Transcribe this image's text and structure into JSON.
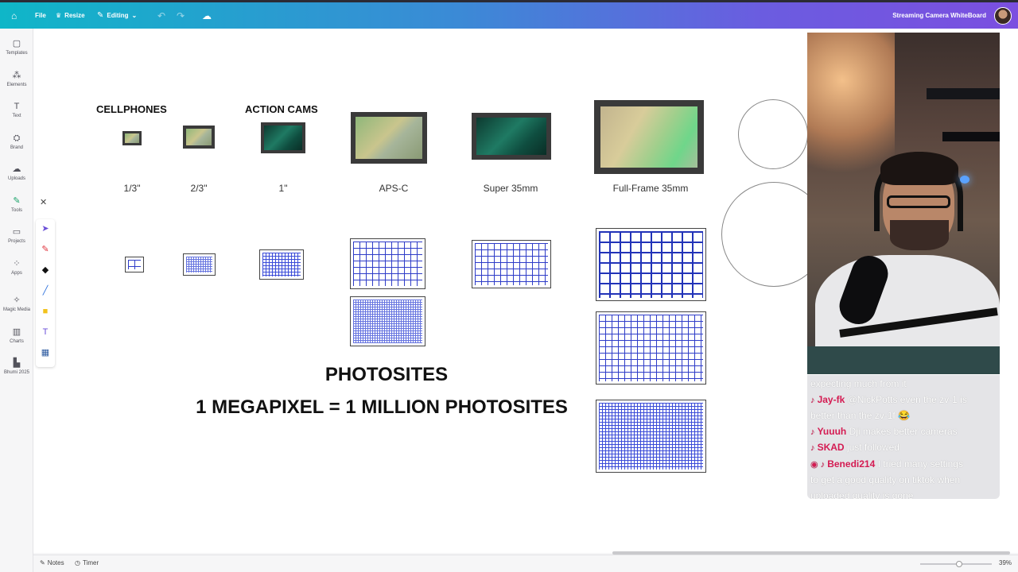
{
  "topbar": {
    "file_label": "File",
    "resize_label": "Resize",
    "editing_label": "Editing",
    "doc_title": "Streaming Camera WhiteBoard"
  },
  "sidebar": {
    "items": [
      {
        "label": "Templates",
        "icon": "templates-icon",
        "glyph": "▢"
      },
      {
        "label": "Elements",
        "icon": "elements-icon",
        "glyph": "⁂"
      },
      {
        "label": "Text",
        "icon": "text-icon",
        "glyph": "T"
      },
      {
        "label": "Brand",
        "icon": "brand-icon",
        "glyph": "⛭"
      },
      {
        "label": "Uploads",
        "icon": "uploads-icon",
        "glyph": "☁"
      },
      {
        "label": "Tools",
        "icon": "tools-icon",
        "glyph": "✎"
      },
      {
        "label": "Projects",
        "icon": "projects-icon",
        "glyph": "▭"
      },
      {
        "label": "Apps",
        "icon": "apps-icon",
        "glyph": "⁘"
      },
      {
        "label": "Magic Media",
        "icon": "magic-media-icon",
        "glyph": "✧"
      },
      {
        "label": "Charts",
        "icon": "charts-icon",
        "glyph": "▥"
      },
      {
        "label": "Bhumi 2025",
        "icon": "bhumi-icon",
        "glyph": "▙"
      }
    ]
  },
  "canvas": {
    "headers": {
      "cellphones": "CELLPHONES",
      "action_cams": "ACTION CAMS"
    },
    "sensor_labels": [
      "1/3\"",
      "2/3\"",
      "1\"",
      "APS-C",
      "Super 35mm",
      "Full-Frame 35mm"
    ],
    "title": "PHOTOSITES",
    "subtitle": "1 MEGAPIXEL = 1 MILLION PHOTOSITES"
  },
  "chat": {
    "lines": [
      {
        "user": "",
        "message": "expecting much from it"
      },
      {
        "user": "Jay-fk",
        "message": "@NickPotts even the zv-1 is"
      },
      {
        "user": "",
        "message": "better than the zv-1f 😂"
      },
      {
        "user": "Yuuuh",
        "message": "Dji makes better cameras"
      },
      {
        "user": "SKAD",
        "message": "just followed"
      },
      {
        "user": "Benedi214",
        "message": "I tried many settings"
      },
      {
        "user": "",
        "message": "to get a good quality on tiktok when"
      },
      {
        "user": "",
        "message": "uploaded quality is gone"
      }
    ]
  },
  "bottombar": {
    "notes_label": "Notes",
    "timer_label": "Timer",
    "zoom": "39%"
  },
  "colors": {
    "accent_gradient_start": "#0fb6c8",
    "accent_gradient_end": "#7b4fe0",
    "grid_blue": "#2233b8",
    "chat_user": "#d41b52"
  }
}
